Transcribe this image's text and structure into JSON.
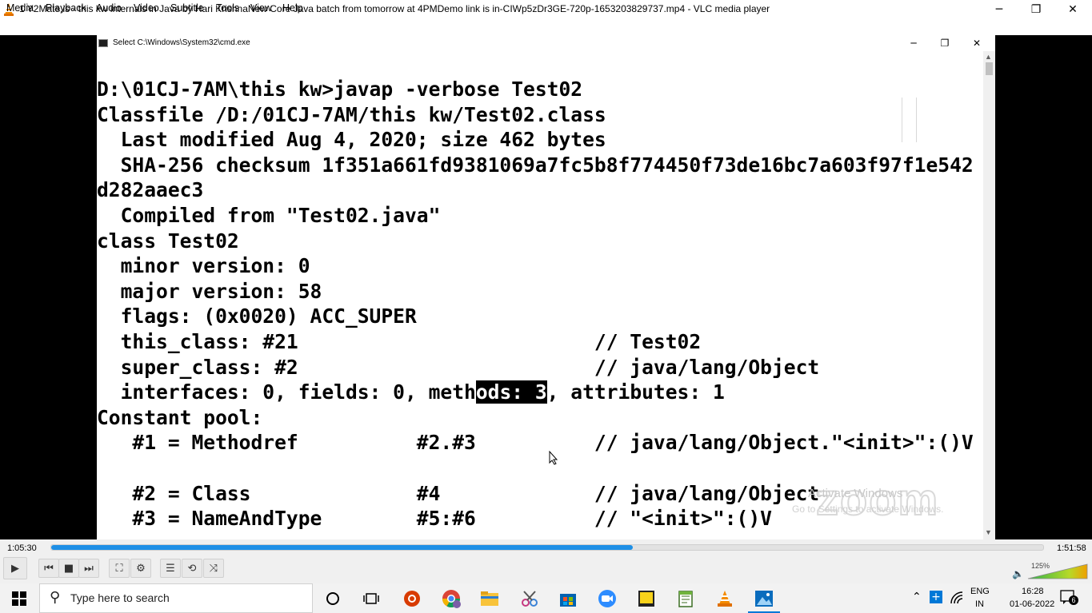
{
  "window": {
    "title": "1 Y2Mate.is - this kw internals in Java by Hari KrishnaNew Core Java batch from tomorrow at 4PMDemo link is in-CIWp5zDr3GE-720p-1653203829737.mp4 - VLC media player",
    "minimize": "─",
    "maximize": "❐",
    "close": "✕"
  },
  "menu": {
    "items": [
      "Media",
      "Playback",
      "Audio",
      "Video",
      "Subtitle",
      "Tools",
      "View",
      "Help"
    ]
  },
  "cmd": {
    "title": "Select C:\\Windows\\System32\\cmd.exe",
    "minimize": "─",
    "maximize": "❐",
    "close": "✕",
    "lines": [
      "D:\\01CJ-7AM\\this kw>javap -verbose Test02",
      "Classfile /D:/01CJ-7AM/this kw/Test02.class",
      "  Last modified Aug 4, 2020; size 462 bytes",
      "  SHA-256 checksum 1f351a661fd9381069a7fc5b8f774450f73de16bc7a603f97f1e542",
      "d282aaec3",
      "  Compiled from \"Test02.java\"",
      "class Test02",
      "  minor version: 0",
      "  major version: 58",
      "  flags: (0x0020) ACC_SUPER",
      "  this_class: #21                         // Test02",
      "  super_class: #2                         // java/lang/Object",
      "",
      "Constant pool:",
      "   #1 = Methodref          #2.#3          // java/lang/Object.\"<init>\":()V",
      "",
      "   #2 = Class              #4             // java/lang/Object",
      "   #3 = NameAndType        #5:#6          // \"<init>\":()V"
    ],
    "interfaces_line": {
      "before": "  interfaces: 0, fields: 0, meth",
      "highlight": "ods: 3",
      "after": ", attributes: 1"
    },
    "watermark": "zoom",
    "activate_title": "Activate Windows",
    "activate_sub": "Go to Settings to activate Windows."
  },
  "player": {
    "time_current": "1:05:30",
    "time_total": "1:51:58",
    "progress": 0.586,
    "volume_percent": "125%",
    "controls": {
      "play": "▶",
      "prev": "⏮",
      "stop": "■",
      "next": "⏭",
      "fullscreen": "⛶",
      "extended": "⚙",
      "playlist": "☰",
      "loop": "⟲",
      "shuffle": "⤨"
    }
  },
  "taskbar": {
    "search_placeholder": "Type here to search",
    "lang_top": "ENG",
    "lang_bottom": "IN",
    "time": "16:28",
    "date": "01-06-2022",
    "notifications": "6"
  },
  "colors": {
    "vlc_orange": "#f48b00",
    "seek_blue": "#1e8fe6",
    "taskbar_bg": "#f2f2f2"
  }
}
